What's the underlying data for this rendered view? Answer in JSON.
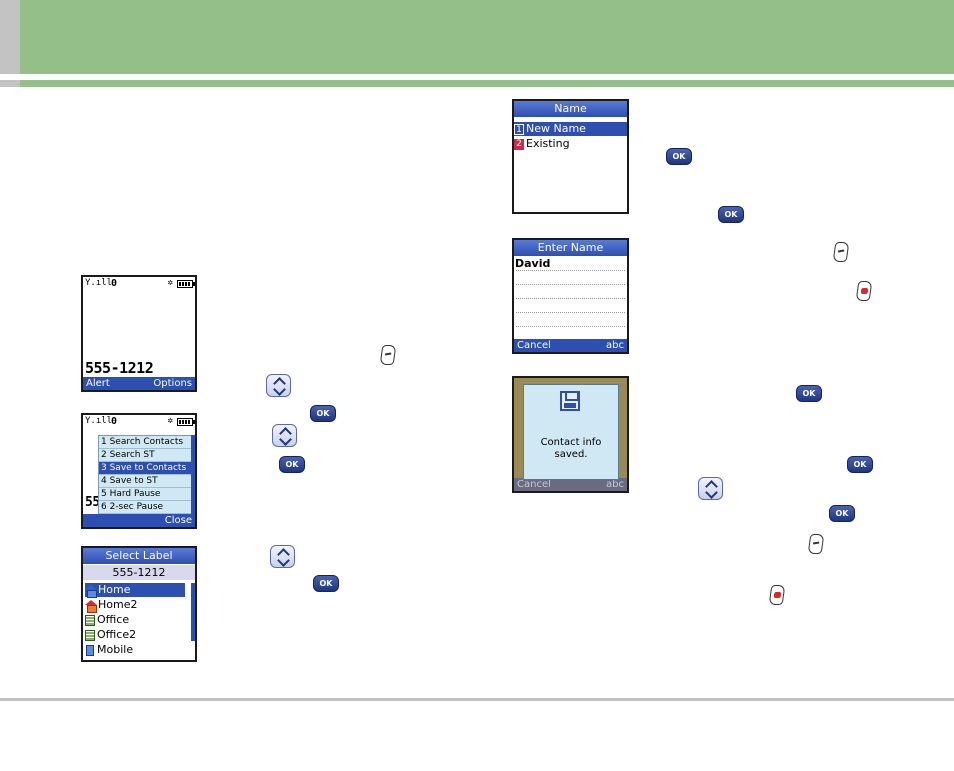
{
  "screens": {
    "dial": {
      "number": "555-1212",
      "status_zero": "0",
      "soft_left": "Alert",
      "soft_right": "Options"
    },
    "options_menu": {
      "status_zero": "0",
      "items": [
        "1 Search Contacts",
        "2 Search ST",
        "3 Save to Contacts",
        "4 Save to ST",
        "5 Hard Pause",
        "6 2-sec Pause"
      ],
      "partial_number": "55",
      "soft_right": "Close"
    },
    "select_label": {
      "title": "Select Label",
      "number": "555-1212",
      "items": [
        "Home",
        "Home2",
        "Office",
        "Office2",
        "Mobile"
      ]
    },
    "name": {
      "title": "Name",
      "options": [
        {
          "badge": "1",
          "label": "New Name"
        },
        {
          "badge": "2",
          "label": "Existing"
        }
      ]
    },
    "enter_name": {
      "title": "Enter Name",
      "value": "David",
      "soft_left": "Cancel",
      "soft_right": "abc"
    },
    "saved": {
      "message_line1": "Contact info",
      "message_line2": "saved.",
      "bg_left": "Cancel",
      "bg_right": "abc"
    }
  },
  "keys": {
    "ok_label": "OK"
  },
  "colors": {
    "header_green": "#94bf88",
    "header_gray": "#c3c3c3",
    "screen_blue": "#2d4fb1"
  }
}
